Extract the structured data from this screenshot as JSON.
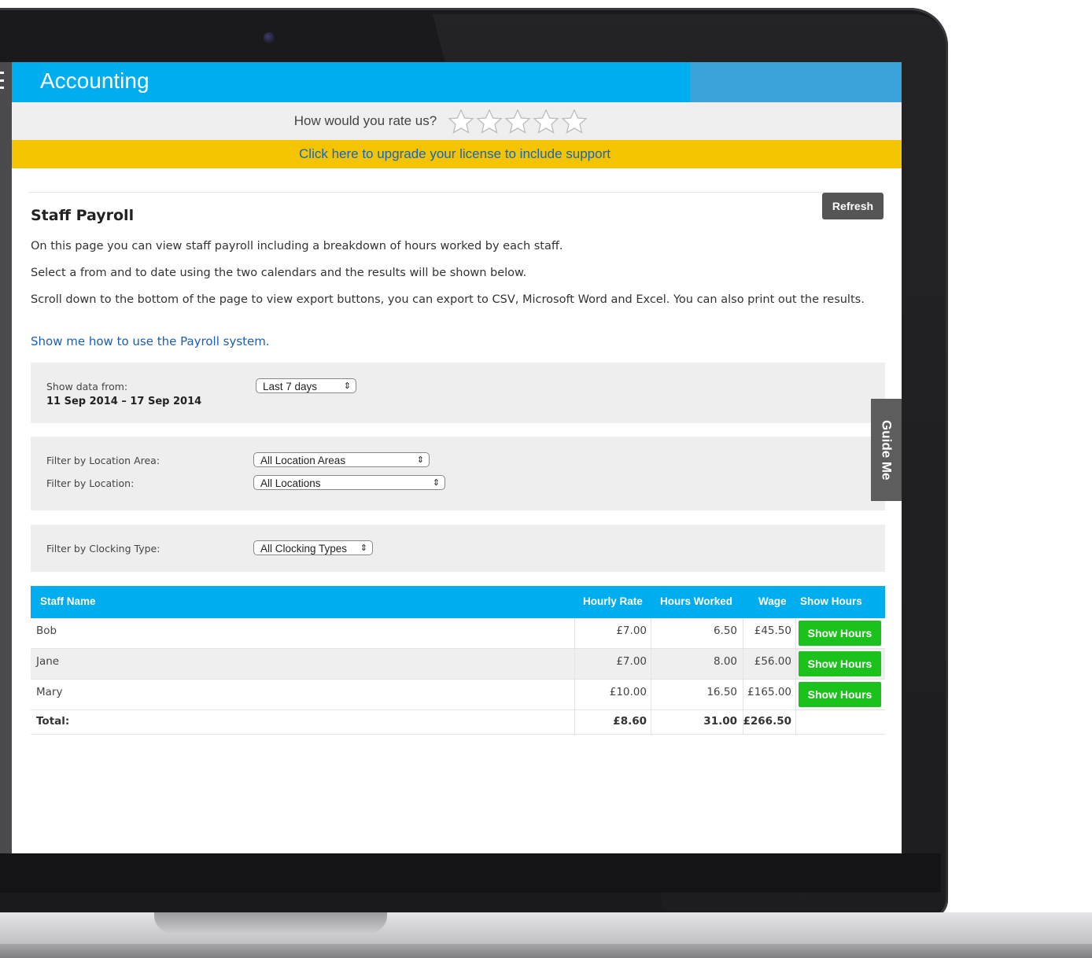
{
  "app": {
    "title": "Accounting"
  },
  "rating": {
    "prompt": "How would you rate us?",
    "stars_total": 5,
    "stars_filled": 0
  },
  "upgrade": {
    "link_text": "Click here to upgrade your license to include support"
  },
  "toolbar": {
    "refresh_label": "Refresh"
  },
  "page": {
    "title": "Staff Payroll",
    "paragraphs": [
      "On this page you can view staff payroll including a breakdown of hours worked by each staff.",
      "Select a from and to date using the two calendars and the results will be shown below.",
      "Scroll down to the bottom of the page to view export buttons, you can export to CSV, Microsoft Word and Excel. You can also print out the results."
    ],
    "help_link": "Show me how to use the Payroll system."
  },
  "filters": {
    "date_label": "Show data from:",
    "date_range": "11 Sep 2014 – 17 Sep 2014",
    "date_select": "Last 7 days",
    "location_area_label": "Filter by Location Area:",
    "location_area_select": "All Location Areas",
    "location_label": "Filter by Location:",
    "location_select": "All Locations",
    "clocking_label": "Filter by Clocking Type:",
    "clocking_select": "All Clocking Types"
  },
  "guide": {
    "label": "Guide Me"
  },
  "table": {
    "headers": {
      "name": "Staff Name",
      "rate": "Hourly Rate",
      "hours": "Hours Worked",
      "wage": "Wage",
      "show": "Show Hours"
    },
    "rows": [
      {
        "name": "Bob",
        "rate": "£7.00",
        "hours": "6.50",
        "wage": "£45.50",
        "button": "Show Hours"
      },
      {
        "name": "Jane",
        "rate": "£7.00",
        "hours": "8.00",
        "wage": "£56.00",
        "button": "Show Hours"
      },
      {
        "name": "Mary",
        "rate": "£10.00",
        "hours": "16.50",
        "wage": "£165.00",
        "button": "Show Hours"
      }
    ],
    "total": {
      "name": "Total:",
      "rate": "£8.60",
      "hours": "31.00",
      "wage": "£266.50"
    }
  },
  "colors": {
    "accent": "#00adef",
    "banner": "#f5c400",
    "button_green": "#1bc21b",
    "refresh": "#555555"
  }
}
